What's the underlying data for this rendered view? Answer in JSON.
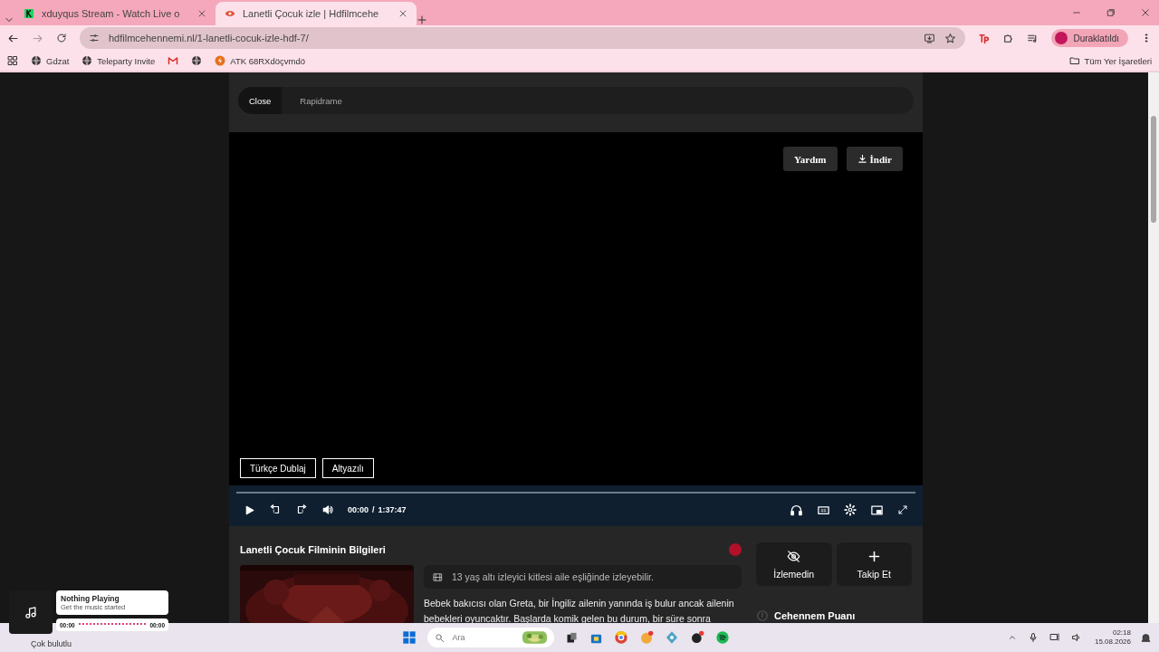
{
  "browser": {
    "tabs": [
      {
        "title": "xduyqus Stream - Watch Live o",
        "selected": false
      },
      {
        "title": "Lanetli Çocuk izle | Hdfilmcehe",
        "selected": true
      }
    ],
    "address": "hdfilmcehennemi.nl/1-lanetli-cocuk-izle-hdf-7/",
    "profile": "Duraklatıldı",
    "bookmarks": [
      {
        "kind": "globe",
        "label": "Gdzat"
      },
      {
        "kind": "globe",
        "label": "Teleparty Invite"
      },
      {
        "kind": "mail"
      },
      {
        "kind": "globe"
      },
      {
        "kind": "bolt",
        "label": "ATK 68RXdöçvmdö"
      }
    ],
    "all_bookmarks": "Tüm Yer İşaretleri"
  },
  "player": {
    "sources": [
      {
        "label": "Close",
        "selected": true
      },
      {
        "label": "Rapidrame",
        "selected": false
      }
    ],
    "top_buttons": [
      "Yardım",
      "İndir"
    ],
    "audio_options": [
      "Türkçe Dublaj",
      "Altyazılı"
    ],
    "progress": {
      "level": 0
    },
    "time": "00:00",
    "separator": "/",
    "duration": "1:37:47"
  },
  "info": {
    "title": "Lanetli Çocuk Filminin Bilgileri",
    "rating_note": "13 yaş altı izleyici kitlesi aile eşliğinde izleyebilir.",
    "description": "Bebek bakıcısı olan Greta, bir İngiliz ailenin yanında iş bulur ancak ailenin bebekleri oyuncaktır. Başlarda komik gelen bu durum, bir süre sonra",
    "actions": [
      {
        "kind": "eye-off",
        "label": "İzlemedin"
      },
      {
        "kind": "plus",
        "label": "Takip Et"
      }
    ],
    "score_title": "Cehennem Puanı"
  },
  "music_widget": {
    "title": "Nothing Playing",
    "subtitle": "Get the music started",
    "start": "00:00",
    "end": "00:00"
  },
  "taskbar": {
    "weather": "Çok bulutlu",
    "search_placeholder": "Ara",
    "time": "02:18",
    "date": "15.08.2026"
  }
}
